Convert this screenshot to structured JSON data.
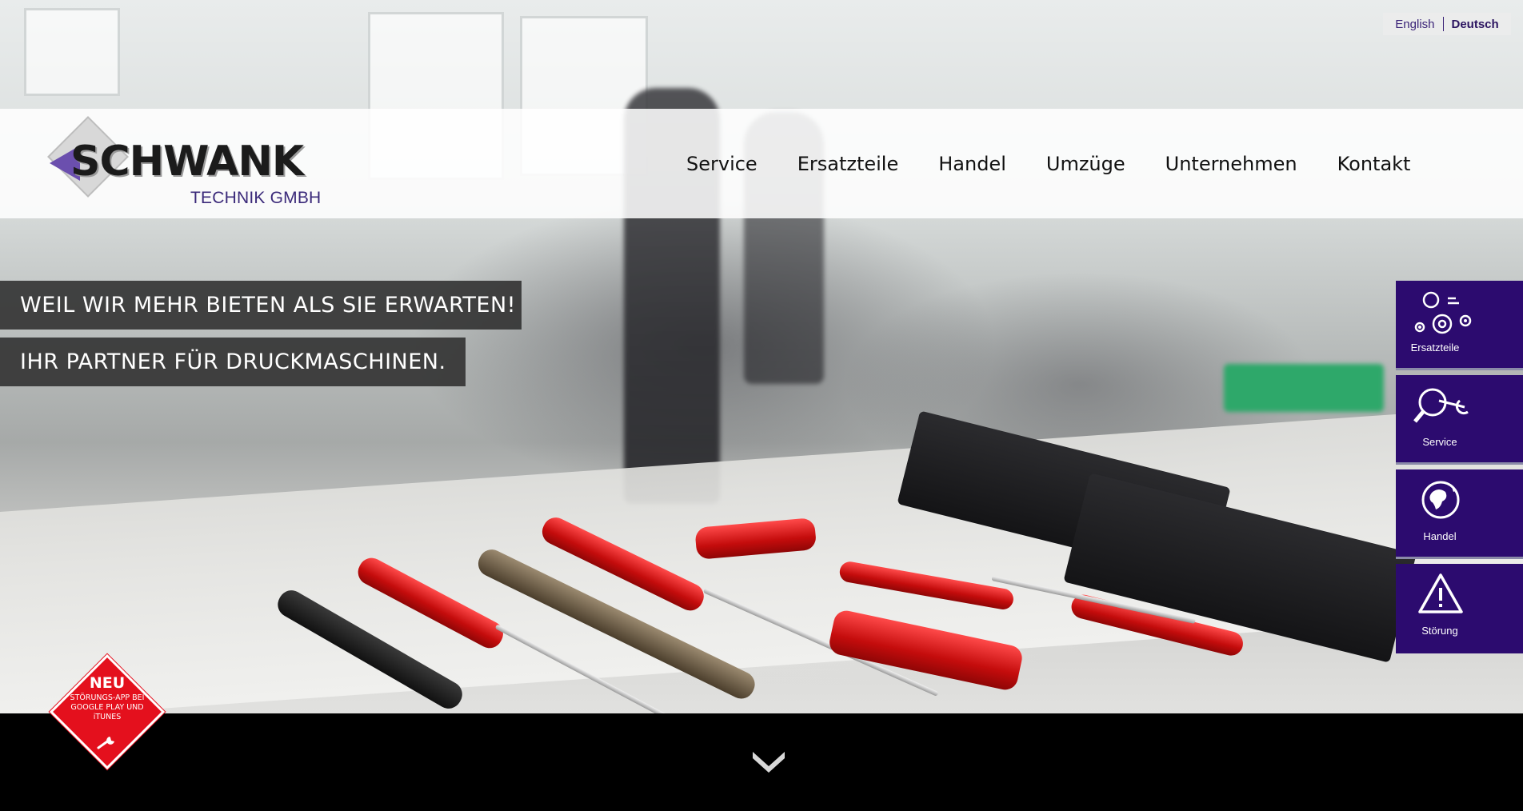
{
  "language_switcher": {
    "english_label": "English",
    "deutsch_label": "Deutsch",
    "active": "Deutsch"
  },
  "header": {
    "logo": {
      "brand": "SCHWANK",
      "subtitle": "TECHNIK GMBH"
    },
    "nav": {
      "items": [
        {
          "label": "Service"
        },
        {
          "label": "Ersatzteile"
        },
        {
          "label": "Handel"
        },
        {
          "label": "Umzüge"
        },
        {
          "label": "Unternehmen"
        },
        {
          "label": "Kontakt"
        }
      ]
    }
  },
  "hero": {
    "slogans": [
      "WEIL WIR MEHR BIETEN ALS SIE ERWARTEN!",
      "IHR PARTNER FÜR DRUCKMASCHINEN."
    ]
  },
  "side_panel": {
    "tiles": [
      {
        "label": "Ersatzteile",
        "icon": "gears-icon"
      },
      {
        "label": "Service",
        "icon": "wrench-magnifier-icon"
      },
      {
        "label": "Handel",
        "icon": "globe-icon"
      },
      {
        "label": "Störung",
        "icon": "warning-icon"
      }
    ]
  },
  "badge": {
    "headline": "NEU",
    "line1": "STÖRUNGS-APP BEI",
    "line2": "GOOGLE PLAY UND",
    "line3": "iTUNES",
    "icon": "wrench-icon"
  },
  "scroll_indicator": {
    "icon": "chevron-down-icon"
  },
  "colors": {
    "brand_purple": "#2c0b6f",
    "badge_red": "#e4101d",
    "slogan_bg": "#323232",
    "footer_black": "#000000"
  }
}
